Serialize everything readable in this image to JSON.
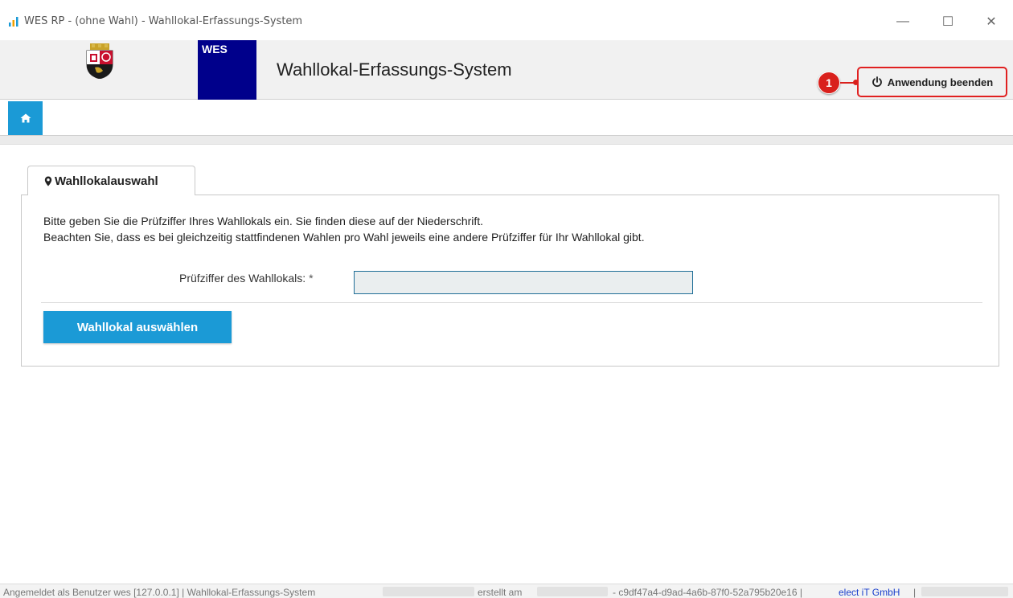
{
  "window": {
    "title": "WES RP - (ohne Wahl) - Wahllokal-Erfassungs-System",
    "minimize": "—",
    "maximize": "☐",
    "close": "✕"
  },
  "header": {
    "wes_label": "WES",
    "app_title": "Wahllokal-Erfassungs-System",
    "logout_label": "Anwendung beenden",
    "marker_number": "1"
  },
  "colors": {
    "accent": "#1b9ad6",
    "wes_block": "#00008b",
    "marker": "#d9201c"
  },
  "tab": {
    "label": "Wahllokalauswahl",
    "icon": "map-pin-icon"
  },
  "panel": {
    "info_line1": "Bitte geben Sie die Prüfziffer Ihres Wahllokals ein. Sie finden diese auf der Niederschrift.",
    "info_line2": "Beachten Sie, dass es bei gleichzeitig stattfindenen Wahlen pro Wahl jeweils eine andere Prüfziffer für Ihr Wahllokal gibt.",
    "field_label": "Prüfziffer des Wahllokals:",
    "required_marker": "*",
    "input_value": "",
    "button_label": "Wahllokal auswählen"
  },
  "footer": {
    "user_text": "Angemeldet als Benutzer wes [127.0.0.1] | Wahllokal-Erfassungs-System",
    "created_text": "erstellt am",
    "build_id": "- c9df47a4-d9ad-4a6b-87f0-52a795b20e16 |",
    "company_link": "elect iT GmbH",
    "trailing": "|"
  }
}
